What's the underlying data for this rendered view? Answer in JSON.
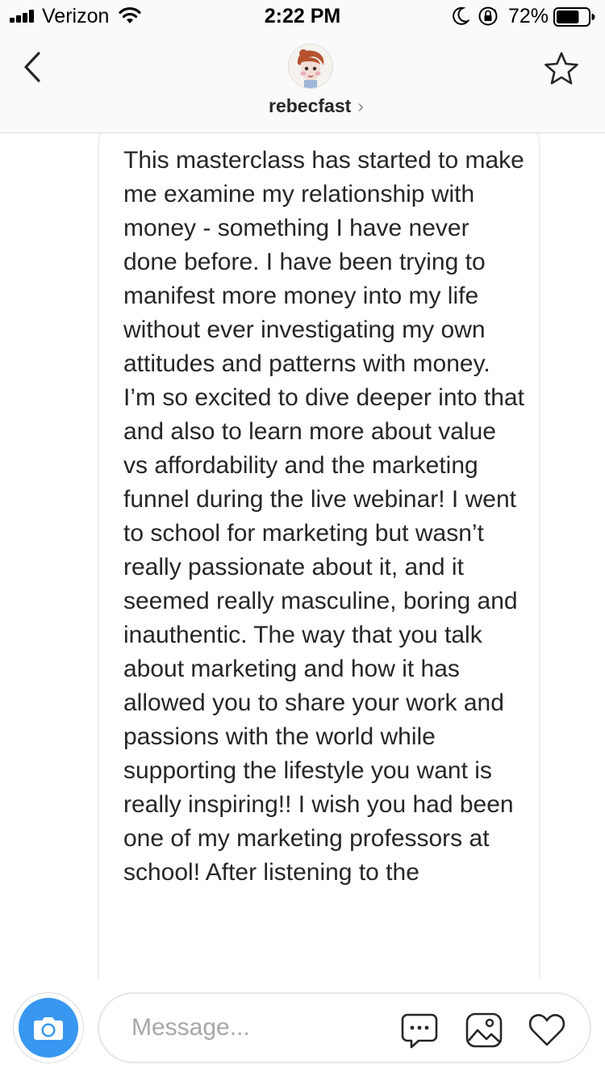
{
  "status_bar": {
    "carrier": "Verizon",
    "time": "2:22 PM",
    "battery": "72%",
    "battery_level": 0.72
  },
  "header": {
    "username": "rebecfast",
    "chevron": "›"
  },
  "message": {
    "text": "This masterclass has started to make me examine my relationship with money - something I have never done before. I have been trying to manifest more money into my life without ever investigating my own attitudes and patterns with money. I’m so excited to dive deeper into that and also to learn more about value vs affordability and the marketing funnel during the live webinar! I went to school for marketing but wasn’t really passionate about it, and it seemed really masculine, boring and inauthentic. The way that you talk about marketing and how it has allowed you to share your work and passions with the world while supporting the lifestyle you want is really inspiring!! I wish you had been one of my marketing professors at school! After listening to the"
  },
  "composer": {
    "placeholder": "Message..."
  },
  "icons": {
    "back": "chevron-left-icon",
    "star": "star-icon",
    "camera": "camera-icon",
    "chat": "chat-bubble-icon",
    "gallery": "image-icon",
    "like": "heart-icon"
  },
  "colors": {
    "accent": "#3897f0",
    "text": "#262626",
    "border": "#dbdbdb"
  }
}
